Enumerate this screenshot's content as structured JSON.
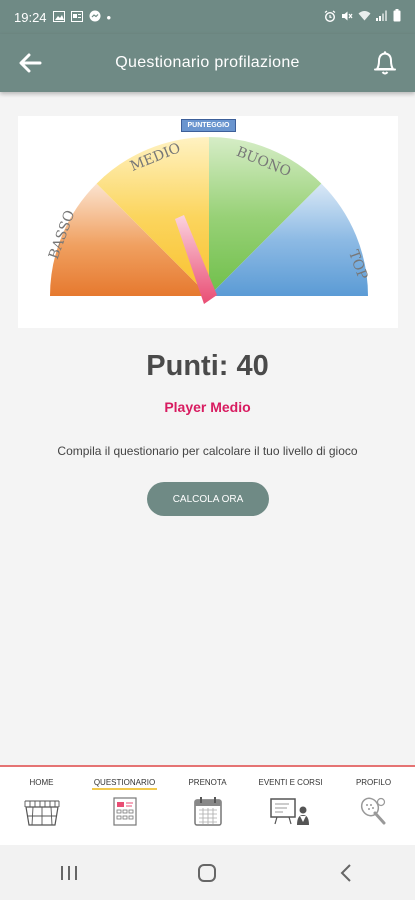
{
  "status_bar": {
    "time": "19:24",
    "dot": "•"
  },
  "app_bar": {
    "title": "Questionario profilazione",
    "back_icon": "arrow-left-icon",
    "bell_icon": "bell-icon"
  },
  "gauge": {
    "badge": "PUNTEGGIO",
    "segments": [
      "BASSO",
      "MEDIO",
      "BUONO",
      "TOP"
    ],
    "colors": {
      "basso": "#e6792f",
      "medio": "#f9c12e",
      "buono": "#6fbf4a",
      "top": "#5b9bd5",
      "needle": "#e94d74"
    }
  },
  "score_label": "Punti: 40",
  "level_label": "Player Medio",
  "hint": "Compila il questionario per calcolare il tuo livello di gioco",
  "calc_button": "CALCOLA ORA",
  "bottom_nav": [
    {
      "label": "HOME",
      "icon": "tennis-court-icon"
    },
    {
      "label": "QUESTIONARIO",
      "icon": "questionnaire-icon",
      "active": true
    },
    {
      "label": "PRENOTA",
      "icon": "calendar-icon"
    },
    {
      "label": "EVENTI E CORSI",
      "icon": "whiteboard-coach-icon"
    },
    {
      "label": "PROFILO",
      "icon": "racket-ball-icon"
    }
  ]
}
